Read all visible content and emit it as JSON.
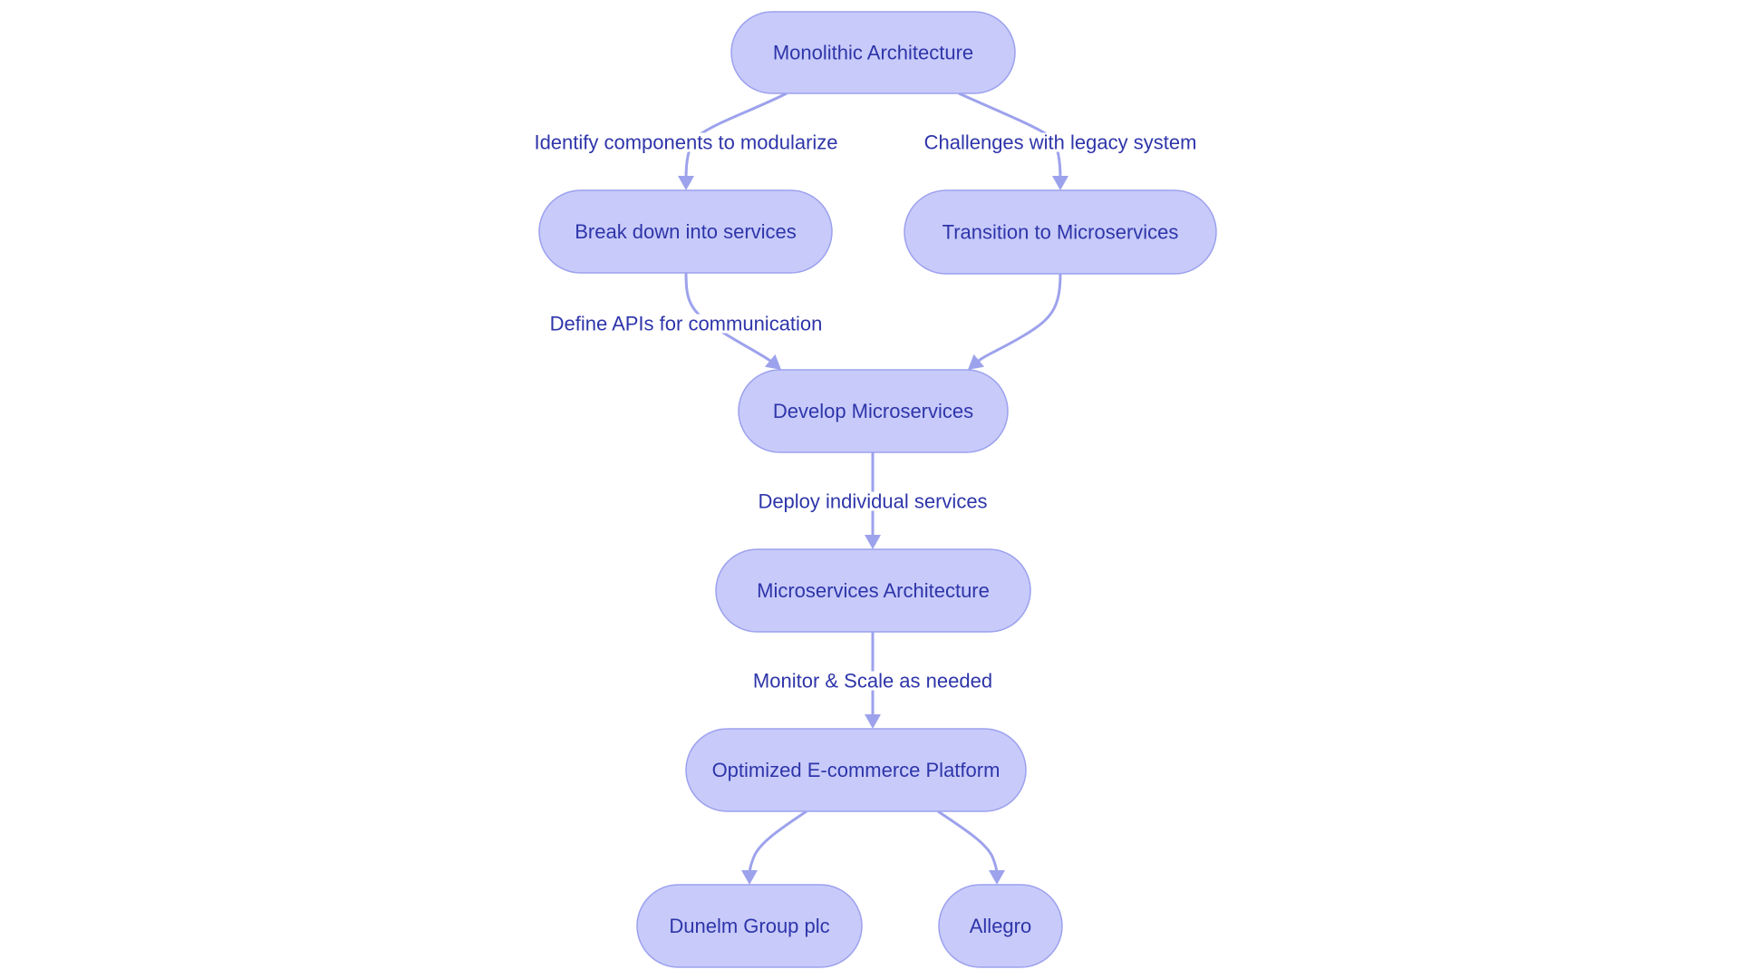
{
  "diagram": {
    "type": "flowchart",
    "direction": "top-down",
    "colors": {
      "node_fill": "#C8CBFA",
      "node_stroke": "#9CA1EE",
      "edge": "#9DA2EC",
      "text": "#2E35A9",
      "background": "#FFFFFF"
    },
    "nodes": [
      {
        "id": "monolithic",
        "label": "Monolithic Architecture"
      },
      {
        "id": "breakdown",
        "label": "Break down into services"
      },
      {
        "id": "transition",
        "label": "Transition to Microservices"
      },
      {
        "id": "develop",
        "label": "Develop Microservices"
      },
      {
        "id": "microarch",
        "label": "Microservices Architecture"
      },
      {
        "id": "optimized",
        "label": "Optimized E-commerce Platform"
      },
      {
        "id": "dunelm",
        "label": "Dunelm Group plc"
      },
      {
        "id": "allegro",
        "label": "Allegro"
      }
    ],
    "edges": [
      {
        "from": "monolithic",
        "to": "breakdown",
        "label": "Identify components to modularize"
      },
      {
        "from": "monolithic",
        "to": "transition",
        "label": "Challenges with legacy system"
      },
      {
        "from": "breakdown",
        "to": "develop",
        "label": "Define APIs for communication"
      },
      {
        "from": "transition",
        "to": "develop",
        "label": ""
      },
      {
        "from": "develop",
        "to": "microarch",
        "label": "Deploy individual services"
      },
      {
        "from": "microarch",
        "to": "optimized",
        "label": "Monitor & Scale as needed"
      },
      {
        "from": "optimized",
        "to": "dunelm",
        "label": ""
      },
      {
        "from": "optimized",
        "to": "allegro",
        "label": ""
      }
    ]
  }
}
